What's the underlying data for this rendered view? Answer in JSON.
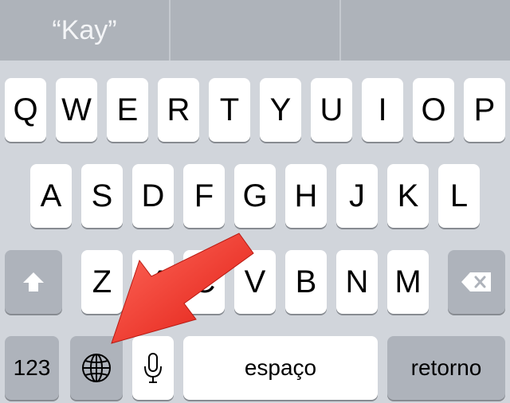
{
  "suggestions": [
    "“Kay”",
    "",
    ""
  ],
  "keyboard": {
    "row1": [
      "Q",
      "W",
      "E",
      "R",
      "T",
      "Y",
      "U",
      "I",
      "O",
      "P"
    ],
    "row2": [
      "A",
      "S",
      "D",
      "F",
      "G",
      "H",
      "J",
      "K",
      "L"
    ],
    "row3": [
      "Z",
      "X",
      "C",
      "V",
      "B",
      "N",
      "M"
    ],
    "numbers_label": "123",
    "space_label": "espaço",
    "return_label": "retorno",
    "shift_icon": "shift-arrow-icon",
    "delete_icon": "backspace-icon",
    "globe_icon": "globe-icon",
    "mic_icon": "microphone-icon"
  },
  "annotation": {
    "color": "#f0281e",
    "points_to": "globe-key"
  }
}
